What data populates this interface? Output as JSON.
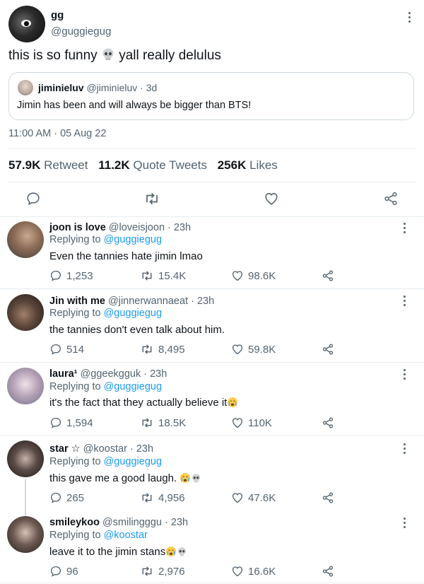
{
  "main_tweet": {
    "name": "gg",
    "handle": "@guggiegug",
    "text_before": "this is so funny",
    "text_after": "yall really delulus",
    "timestamp": "11:00 AM · 05 Aug 22",
    "quoted": {
      "name": "jiminieluv",
      "handle": "@jiminieluv",
      "time": "· 3d",
      "text": "Jimin has been and will always be bigger than BTS!"
    },
    "stats": {
      "retweets_count": "57.9K",
      "retweets_label": "Retweet",
      "quotes_count": "11.2K",
      "quotes_label": "Quote Tweets",
      "likes_count": "256K",
      "likes_label": "Likes"
    }
  },
  "replies": [
    {
      "name": "joon is love",
      "handle": "@loveisjoon",
      "time": "· 23h",
      "replying_prefix": "Replying to",
      "replying_to": "@guggiegug",
      "text": "Even the tannies hate jimin lmao",
      "comments": "1,253",
      "retweets": "15.4K",
      "likes": "98.6K"
    },
    {
      "name": "Jin with me",
      "handle": "@jinnerwannaeat",
      "time": "· 23h",
      "replying_prefix": "Replying to",
      "replying_to": "@guggiegug",
      "text": "the tannies don't even talk about him.",
      "comments": "514",
      "retweets": "8,495",
      "likes": "59.8K"
    },
    {
      "name": "laura¹",
      "handle": "@ggeekgguk",
      "time": "· 23h",
      "replying_prefix": "Replying to",
      "replying_to": "@guggiegug",
      "text": "it's the fact that they actually believe it",
      "comments": "1,594",
      "retweets": "18.5K",
      "likes": "110K"
    },
    {
      "name": "star ☆",
      "handle": "@koostar",
      "time": "· 23h",
      "replying_prefix": "Replying to",
      "replying_to": "@guggiegug",
      "text": "this gave me a good laugh.",
      "comments": "265",
      "retweets": "4,956",
      "likes": "47.6K"
    },
    {
      "name": "smileykoo",
      "handle": "@smilingggu",
      "time": "· 23h",
      "replying_prefix": "Replying to",
      "replying_to": "@koostar",
      "text": "leave it to the jimin stans",
      "comments": "96",
      "retweets": "2,976",
      "likes": "16.6K"
    }
  ],
  "icons": {
    "comment": "comment-icon",
    "retweet": "retweet-icon",
    "like": "heart-icon",
    "share": "share-icon",
    "more": "more-options-icon",
    "skull": "skull-emoji",
    "crying": "crying-emoji"
  },
  "colors": {
    "link": "#1d9bf0",
    "muted": "#536471",
    "divider": "#e6ecf0"
  }
}
